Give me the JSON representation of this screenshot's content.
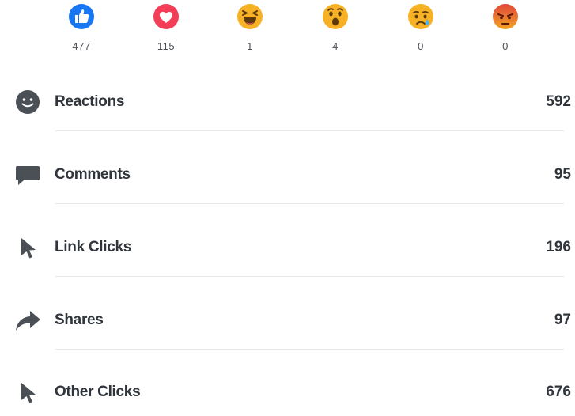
{
  "reactions": [
    {
      "name": "like",
      "count": "477",
      "color": "#1877f2"
    },
    {
      "name": "love",
      "count": "115",
      "color": "#f33e58"
    },
    {
      "name": "haha",
      "count": "1",
      "color": "#f7b125"
    },
    {
      "name": "wow",
      "count": "4",
      "color": "#f7b125"
    },
    {
      "name": "sad",
      "count": "0",
      "color": "#f7b125"
    },
    {
      "name": "angry",
      "count": "0",
      "color": "#e9710f"
    }
  ],
  "metrics": [
    {
      "icon": "smiley-icon",
      "label": "Reactions",
      "value": "592"
    },
    {
      "icon": "comment-bubble-icon",
      "label": "Comments",
      "value": "95"
    },
    {
      "icon": "cursor-icon",
      "label": "Link Clicks",
      "value": "196"
    },
    {
      "icon": "share-arrow-icon",
      "label": "Shares",
      "value": "97"
    },
    {
      "icon": "cursor-icon",
      "label": "Other Clicks",
      "value": "676"
    }
  ],
  "colors": {
    "text": "#30343b",
    "muted": "#4b4f56",
    "divider": "#e4e6eb",
    "icon": "#4b4f56"
  }
}
